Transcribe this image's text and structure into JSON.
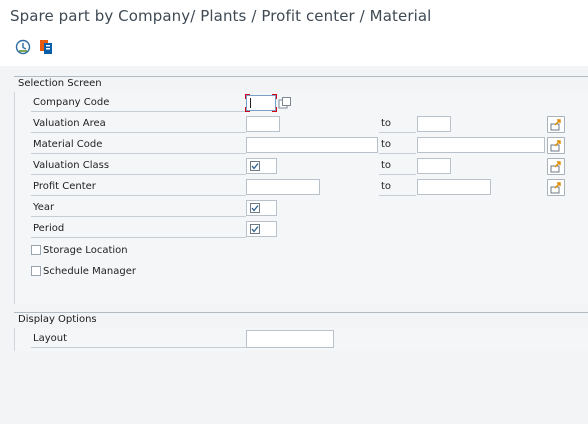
{
  "header": {
    "title": "Spare part by Company/ Plants / Profit center / Material"
  },
  "toolbar": {
    "execute_icon": "execute-clock-icon",
    "variant_icon": "get-variant-icon"
  },
  "selection": {
    "title": "Selection Screen",
    "rows": [
      {
        "label": "Company Code",
        "value": "",
        "has_range": false
      },
      {
        "label": "Valuation Area",
        "value": "",
        "to": "to",
        "to_value": "",
        "has_range": true
      },
      {
        "label": "Material Code",
        "value": "",
        "to": "to",
        "to_value": "",
        "has_range": true
      },
      {
        "label": "Valuation Class",
        "checked": true,
        "to": "to",
        "to_value": "",
        "has_range": true
      },
      {
        "label": "Profit Center",
        "value": "",
        "to": "to",
        "to_value": "",
        "has_range": true
      },
      {
        "label": "Year",
        "checked": true
      },
      {
        "label": "Period",
        "checked": true
      }
    ],
    "checkboxes": [
      {
        "label": "Storage Location",
        "checked": false
      },
      {
        "label": "Schedule Manager",
        "checked": false
      }
    ]
  },
  "display": {
    "title": "Display Options",
    "layout_label": "Layout",
    "layout_value": ""
  },
  "colors": {
    "background": "#f2f4f6",
    "focus_marker": "#d0021b",
    "title_text": "#3f4a55"
  }
}
